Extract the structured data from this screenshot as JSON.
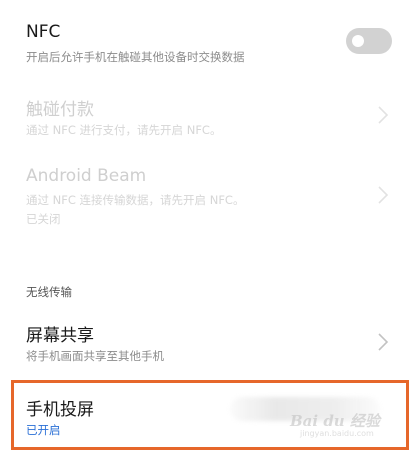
{
  "nfc": {
    "title": "NFC",
    "subtitle": "开启后允许手机在触碰其他设备时交换数据",
    "toggle_state": "off"
  },
  "touch_pay": {
    "title": "触碰付款",
    "subtitle": "通过 NFC 进行支付，请先开启 NFC。"
  },
  "android_beam": {
    "title": "Android Beam",
    "subtitle": "通过 NFC 连接传输数据，请先开启 NFC。",
    "status": "已关闭"
  },
  "section": {
    "label": "无线传输"
  },
  "screen_share": {
    "title": "屏幕共享",
    "subtitle": "将手机画面共享至其他手机"
  },
  "screen_cast": {
    "title": "手机投屏",
    "status": "已开启"
  },
  "watermark": {
    "text": "Bai du 经验",
    "sub": "jingyan.baidu.com"
  },
  "colors": {
    "highlight": "#e6672a",
    "status_on": "#2a6fd6",
    "toggle_off": "#d2d2d2"
  }
}
